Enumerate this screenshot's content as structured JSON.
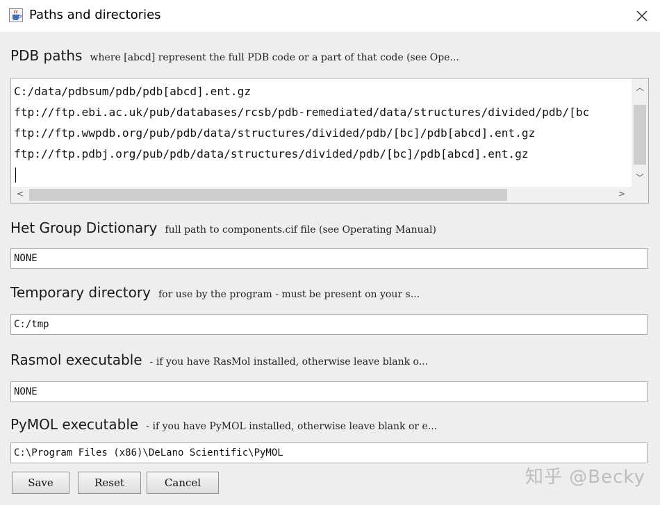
{
  "window": {
    "title": "Paths and directories",
    "icon": "java-cup-icon",
    "close_glyph": "✕"
  },
  "pdb_paths": {
    "heading": "PDB paths",
    "hint": "where [abcd] represent the full PDB code or a part of that code (see Ope...",
    "lines": [
      "C:/data/pdbsum/pdb/pdb[abcd].ent.gz",
      "ftp://ftp.ebi.ac.uk/pub/databases/rcsb/pdb-remediated/data/structures/divided/pdb/[bc",
      "ftp://ftp.wwpdb.org/pub/pdb/data/structures/divided/pdb/[bc]/pdb[abcd].ent.gz",
      "ftp://ftp.pdbj.org/pub/pdb/data/structures/divided/pdb/[bc]/pdb[abcd].ent.gz"
    ]
  },
  "het_group": {
    "heading": "Het Group Dictionary",
    "hint": "full path to components.cif file (see Operating Manual)",
    "value": "NONE"
  },
  "temp_dir": {
    "heading": "Temporary directory",
    "hint": "for use by the program - must be present on your s...",
    "value": "C:/tmp"
  },
  "rasmol": {
    "heading": "Rasmol executable",
    "hint": "- if you have RasMol installed, otherwise leave blank o...",
    "value": "NONE"
  },
  "pymol": {
    "heading": "PyMOL executable",
    "hint": "- if you have PyMOL installed, otherwise leave blank or e...",
    "value": "C:\\Program Files (x86)\\DeLano Scientific\\PyMOL"
  },
  "buttons": {
    "save": "Save",
    "reset": "Reset",
    "cancel": "Cancel"
  },
  "watermark": "知乎 @Becky"
}
